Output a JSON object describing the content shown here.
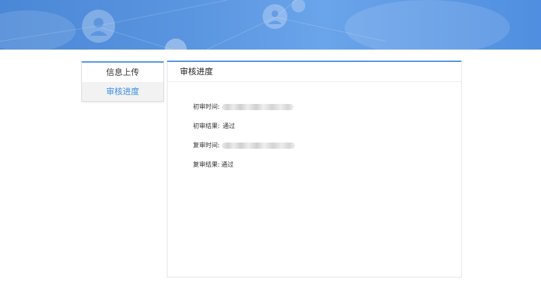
{
  "sidebar": {
    "items": [
      {
        "label": "信息上传",
        "active": false
      },
      {
        "label": "审核进度",
        "active": true
      }
    ]
  },
  "panel": {
    "title": "审核进度",
    "rows": [
      {
        "label": "初审时间:",
        "value": "",
        "redacted": true
      },
      {
        "label": "初审结果:",
        "value": "通过",
        "redacted": false
      },
      {
        "label": "复审时间:",
        "value": "",
        "redacted": true
      },
      {
        "label": "复审结果:",
        "value": "通过",
        "redacted": false
      }
    ]
  },
  "colors": {
    "accent": "#4a90e2",
    "active_text": "#3c8ee8",
    "banner_start": "#4a87d6",
    "banner_end": "#4f8ee0"
  },
  "icons": {
    "banner_decor": "user-network-icon"
  }
}
